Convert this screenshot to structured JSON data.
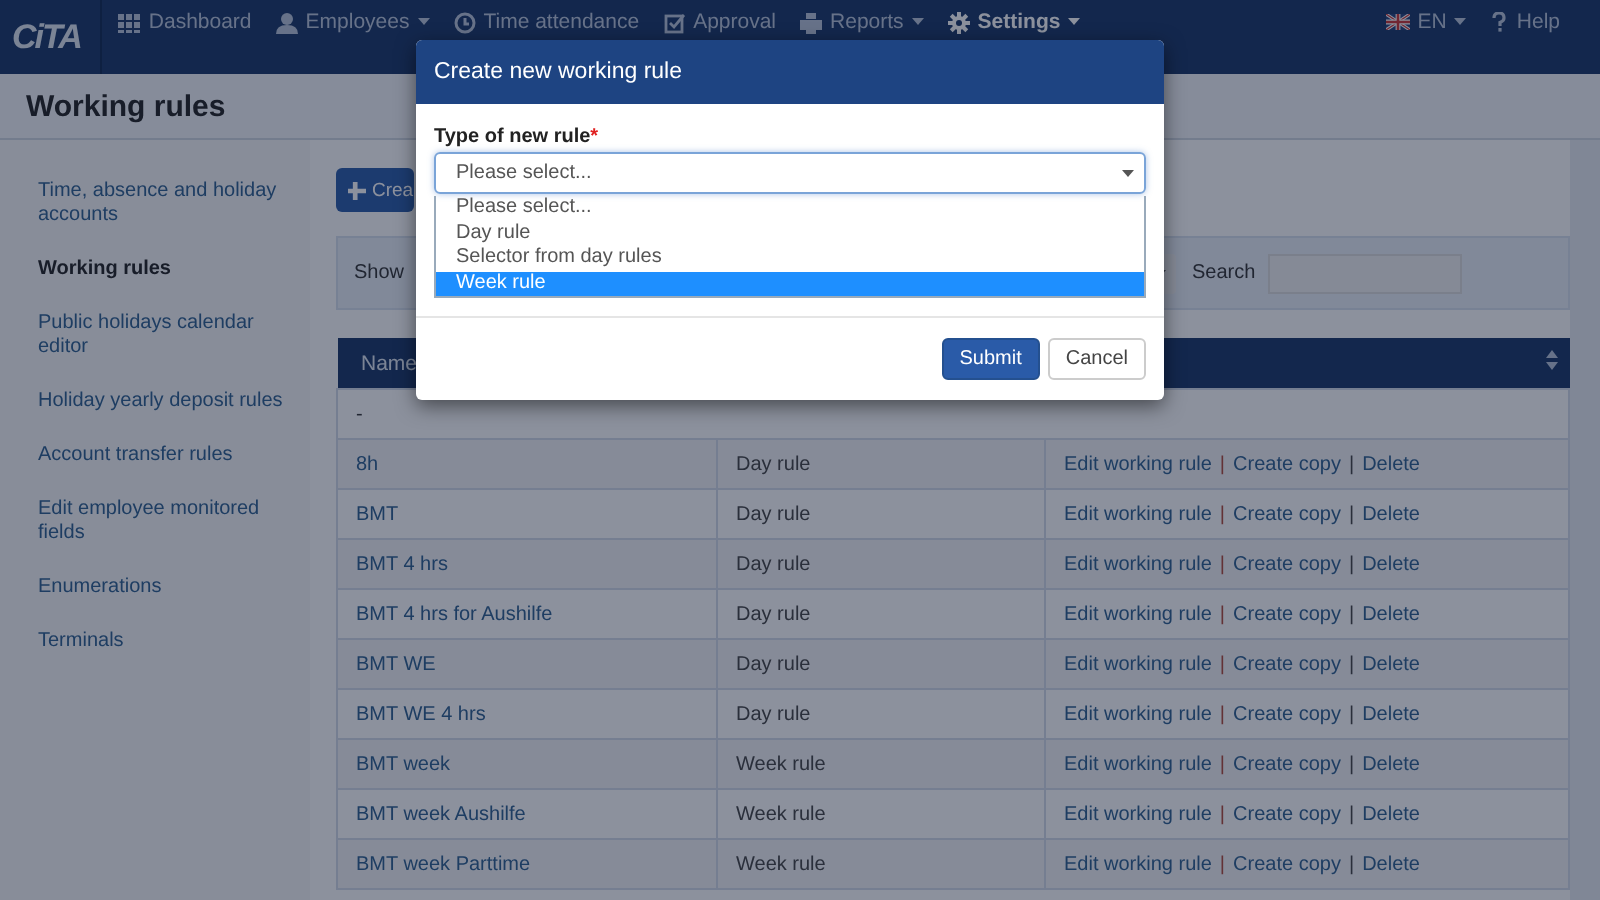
{
  "navbar": {
    "logo": "CiTA",
    "items": [
      {
        "label": "Dashboard",
        "dropdown": false,
        "selected": false
      },
      {
        "label": "Employees",
        "dropdown": true,
        "selected": false
      },
      {
        "label": "Time attendance",
        "dropdown": false,
        "selected": false
      },
      {
        "label": "Approval",
        "dropdown": false,
        "selected": false
      },
      {
        "label": "Reports",
        "dropdown": true,
        "selected": false
      },
      {
        "label": "Settings",
        "dropdown": true,
        "selected": true
      }
    ],
    "language": "EN",
    "help": "Help"
  },
  "page_title": "Working rules",
  "sidebar": {
    "items": [
      {
        "label": "Time, absence and holiday accounts",
        "selected": false
      },
      {
        "label": "Working rules",
        "selected": true
      },
      {
        "label": "Public holidays calendar editor",
        "selected": false
      },
      {
        "label": "Holiday yearly deposit rules",
        "selected": false
      },
      {
        "label": "Account transfer rules",
        "selected": false
      },
      {
        "label": "Edit employee monitored fields",
        "selected": false
      },
      {
        "label": "Enumerations",
        "selected": false
      },
      {
        "label": "Terminals",
        "selected": false
      }
    ]
  },
  "create_button": "Crea",
  "filter": {
    "show_label": "Show",
    "search_label": "Search"
  },
  "table": {
    "columns": [
      "Name"
    ],
    "action_separator": "|",
    "rows": [
      {
        "kind": "group",
        "name": "-"
      },
      {
        "kind": "rule",
        "name": "8h",
        "type": "Day rule",
        "actions": [
          "Edit working rule",
          "Create copy",
          "Delete"
        ]
      },
      {
        "kind": "rule",
        "name": "BMT",
        "type": "Day rule",
        "actions": [
          "Edit working rule",
          "Create copy",
          "Delete"
        ]
      },
      {
        "kind": "rule",
        "name": "BMT 4 hrs",
        "type": "Day rule",
        "actions": [
          "Edit working rule",
          "Create copy",
          "Delete"
        ]
      },
      {
        "kind": "rule",
        "name": "BMT 4 hrs for Aushilfe",
        "type": "Day rule",
        "actions": [
          "Edit working rule",
          "Create copy",
          "Delete"
        ]
      },
      {
        "kind": "rule",
        "name": "BMT WE",
        "type": "Day rule",
        "actions": [
          "Edit working rule",
          "Create copy",
          "Delete"
        ]
      },
      {
        "kind": "rule",
        "name": "BMT WE 4 hrs",
        "type": "Day rule",
        "actions": [
          "Edit working rule",
          "Create copy",
          "Delete"
        ]
      },
      {
        "kind": "rule",
        "name": "BMT week",
        "type": "Week rule",
        "actions": [
          "Edit working rule",
          "Create copy",
          "Delete"
        ]
      },
      {
        "kind": "rule",
        "name": "BMT week Aushilfe",
        "type": "Week rule",
        "actions": [
          "Edit working rule",
          "Create copy",
          "Delete"
        ]
      },
      {
        "kind": "rule",
        "name": "BMT week Parttime",
        "type": "Week rule",
        "actions": [
          "Edit working rule",
          "Create copy",
          "Delete"
        ]
      }
    ]
  },
  "modal": {
    "title": "Create new working rule",
    "field_label": "Type of new rule",
    "required_mark": "*",
    "select_value": "Please select...",
    "options": [
      {
        "label": "Please select...",
        "selected": false
      },
      {
        "label": "Day rule",
        "selected": false
      },
      {
        "label": "Selector from day rules",
        "selected": false
      },
      {
        "label": "Week rule",
        "selected": true
      }
    ],
    "buttons": [
      {
        "label": "Submit",
        "kind": "primary"
      },
      {
        "label": "Cancel",
        "kind": "default"
      }
    ]
  }
}
